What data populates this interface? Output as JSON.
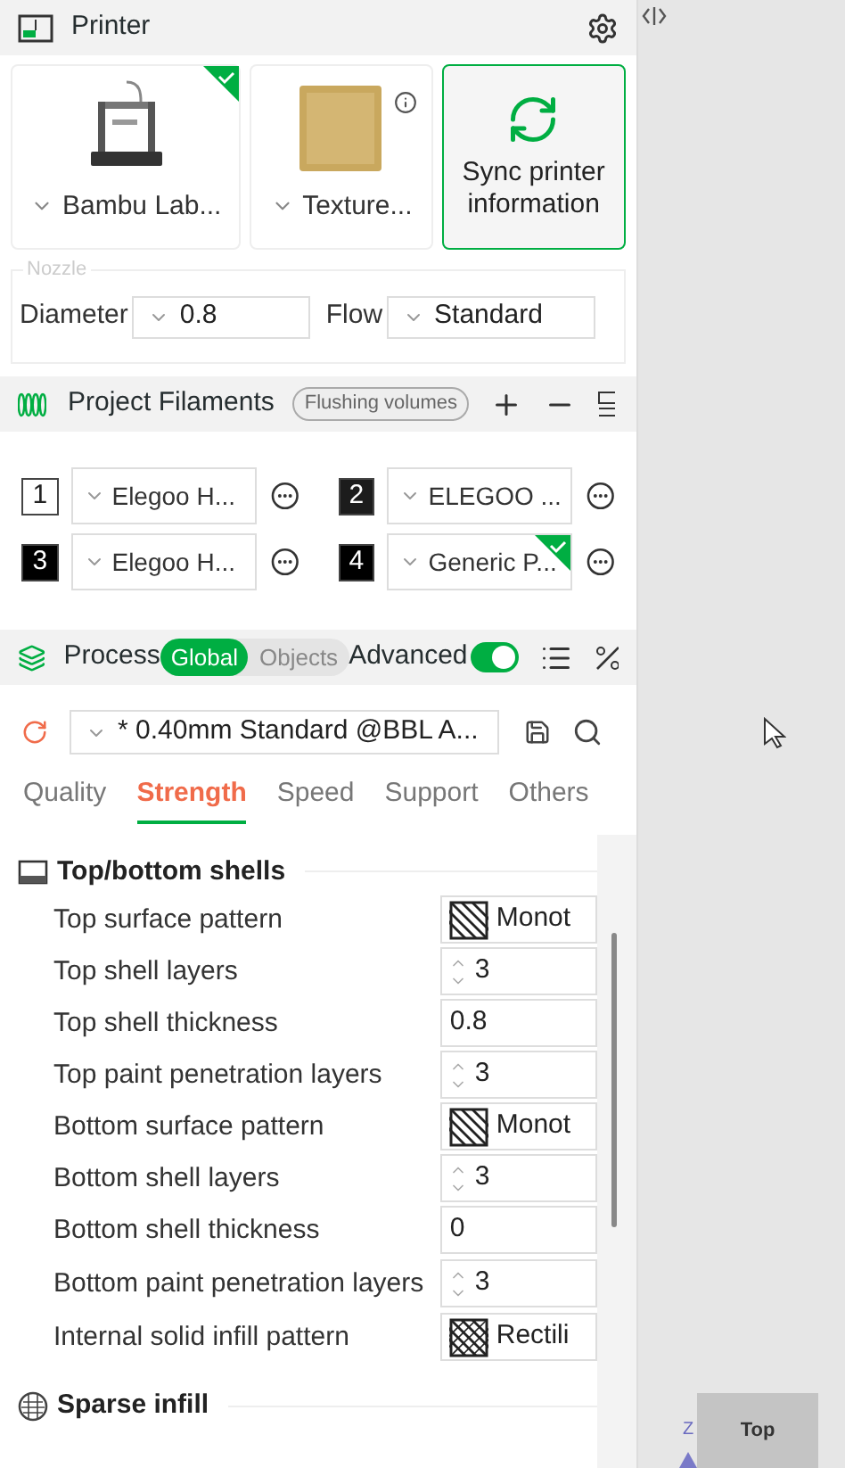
{
  "printer": {
    "title": "Printer",
    "cards": [
      {
        "kind": "printer",
        "label": "Bambu Lab...",
        "selected": true
      },
      {
        "kind": "plate",
        "label": "Texture..."
      },
      {
        "kind": "sync",
        "label": "Sync printer information"
      }
    ],
    "nozzle": {
      "legend": "Nozzle",
      "fields": [
        {
          "label": "Diameter",
          "value": "0.8"
        },
        {
          "label": "Flow",
          "value": "Standard"
        }
      ]
    }
  },
  "filaments": {
    "title": "Project Filaments",
    "flush_button": "Flushing volumes",
    "items": [
      {
        "number": "1",
        "name": "Elegoo H...",
        "color": "#ffffff",
        "selected": false
      },
      {
        "number": "2",
        "name": "ELEGOO ...",
        "color": "#1c1c1c",
        "selected": false
      },
      {
        "number": "3",
        "name": "Elegoo H...",
        "color": "#000000",
        "selected": false
      },
      {
        "number": "4",
        "name": "Generic P...",
        "color": "#000000",
        "selected": true
      }
    ]
  },
  "process": {
    "title": "Process",
    "scope": [
      {
        "label": "Global",
        "selected": true
      },
      {
        "label": "Objects",
        "selected": false
      }
    ],
    "advanced": {
      "label": "Advanced",
      "on": true
    },
    "preset": "* 0.40mm Standard @BBL A...",
    "tabs": [
      {
        "label": "Quality",
        "selected": false
      },
      {
        "label": "Strength",
        "selected": true
      },
      {
        "label": "Speed",
        "selected": false
      },
      {
        "label": "Support",
        "selected": false
      },
      {
        "label": "Others",
        "selected": false
      }
    ],
    "sections": [
      {
        "kind": "shells",
        "title": "Top/bottom shells",
        "rows": [
          {
            "label": "Top surface pattern",
            "kind": "pattern",
            "value": "Monot"
          },
          {
            "label": "Top shell layers",
            "kind": "spin",
            "value": "3"
          },
          {
            "label": "Top shell thickness",
            "kind": "text",
            "value": "0.8"
          },
          {
            "label": "Top paint penetration layers",
            "kind": "spin",
            "value": "3"
          },
          {
            "label": "Bottom surface pattern",
            "kind": "pattern",
            "value": "Monot"
          },
          {
            "label": "Bottom shell layers",
            "kind": "spin",
            "value": "3"
          },
          {
            "label": "Bottom shell thickness",
            "kind": "text",
            "value": "0"
          },
          {
            "label": "Bottom paint penetration layers",
            "kind": "spin",
            "value": "3"
          },
          {
            "label": "Internal solid infill pattern",
            "kind": "grid",
            "value": "Rectili"
          }
        ]
      },
      {
        "kind": "infill",
        "title": "Sparse infill"
      }
    ]
  },
  "viewport": {
    "view_button": "Top",
    "axis_label": "Z"
  }
}
